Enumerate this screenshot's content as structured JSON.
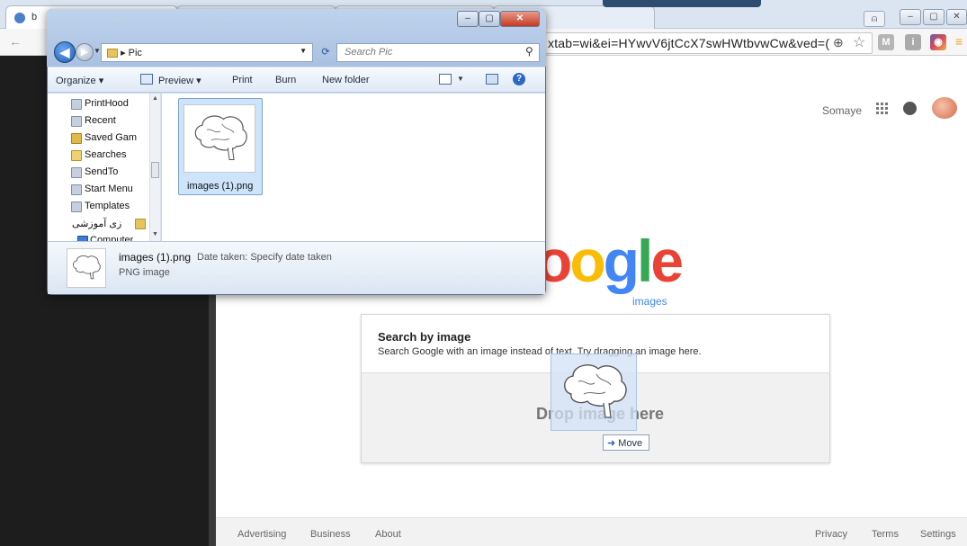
{
  "chrome": {
    "tabs": [
      {
        "label": "b",
        "color": "#4a7fc9"
      },
      {
        "label": "",
        "color": "#d93025"
      },
      {
        "label": "",
        "color": "#4a7fc9"
      },
      {
        "label": "",
        "color": "#d93025"
      }
    ],
    "url": "xtab=wi&ei=HYwvV6jtCcX7swHWtbvwCw&ved=(",
    "extensions": [
      "zoom-icon",
      "star-icon",
      "gmail-icon",
      "instapaper-icon",
      "instagram-icon",
      "menu-icon"
    ],
    "extension_labels": {
      "gmail": "M",
      "instapaper": "i"
    }
  },
  "google": {
    "account_name": "Somaye",
    "logo_visible_text": "oogle",
    "logo_sub": "images",
    "logo_colors": {
      "o1": "#ea4335",
      "o2": "#fbbc05",
      "g": "#4285f4",
      "l": "#34a853",
      "e": "#ea4335"
    },
    "search_by_image": {
      "title": "Search by image",
      "description": "Search Google with an image instead of text. Try dragging an image here.",
      "drop_text": "Drop image here",
      "move_tooltip": "Move"
    },
    "footer": {
      "left_links": [
        "Advertising",
        "Business",
        "About"
      ],
      "right_links": [
        "Privacy",
        "Terms",
        "Settings"
      ]
    }
  },
  "explorer": {
    "breadcrumb_separator": "▸",
    "folder": "Pic",
    "search_placeholder": "Search Pic",
    "commands": {
      "organize": "Organize ▾",
      "preview": "Preview ▾",
      "print": "Print",
      "burn": "Burn",
      "new_folder": "New folder"
    },
    "nav_items": [
      {
        "label": "PrintHood",
        "icon": "shortcut-folder-icon"
      },
      {
        "label": "Recent",
        "icon": "recent-folder-icon"
      },
      {
        "label": "Saved Gam",
        "icon": "saved-games-icon"
      },
      {
        "label": "Searches",
        "icon": "searches-folder-icon"
      },
      {
        "label": "SendTo",
        "icon": "shortcut-folder-icon"
      },
      {
        "label": "Start Menu",
        "icon": "shortcut-folder-icon"
      },
      {
        "label": "Templates",
        "icon": "shortcut-folder-icon"
      },
      {
        "label": "زی آموزشی",
        "icon": "folder-icon"
      },
      {
        "label": "Computer",
        "icon": "computer-icon"
      }
    ],
    "file": {
      "name": "images (1).png"
    },
    "details": {
      "name": "images (1).png",
      "type": "PNG image",
      "date_label": "Date taken: Specify date taken"
    }
  }
}
